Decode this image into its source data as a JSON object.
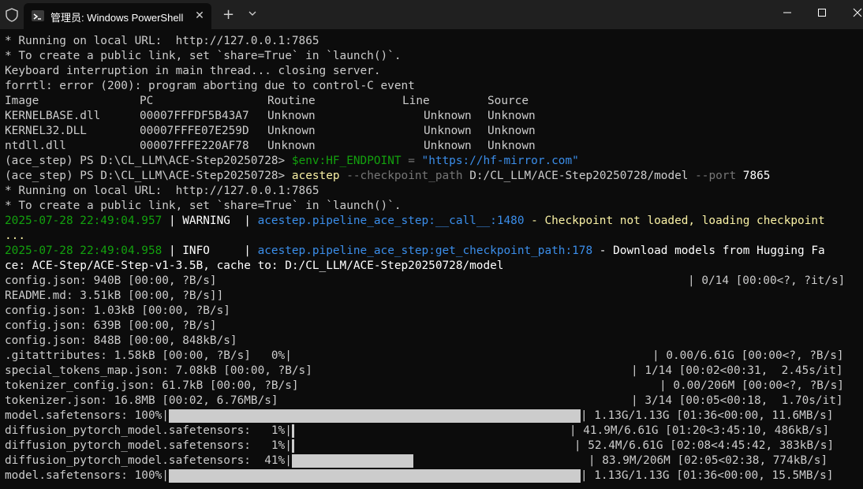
{
  "window": {
    "tab_title": "管理员: Windows PowerShell",
    "tab_close": "✕",
    "new_tab": "+"
  },
  "terminal": {
    "l1": "* Running on local URL:  http://127.0.0.1:7865",
    "l2": "* To create a public link, set `share=True` in `launch()`.",
    "l3": "Keyboard interruption in main thread... closing server.",
    "l4": "forrtl: error (200): program aborting due to control-C event",
    "table_header": [
      "Image",
      "PC",
      "Routine",
      "Line",
      "Source"
    ],
    "table_rows": [
      [
        "KERNELBASE.dll",
        "00007FFFDF5B43A7",
        "Unknown",
        "Unknown",
        "Unknown"
      ],
      [
        "KERNEL32.DLL",
        "00007FFFE07E259D",
        "Unknown",
        "Unknown",
        "Unknown"
      ],
      [
        "ntdll.dll",
        "00007FFFE220AF78",
        "Unknown",
        "Unknown",
        "Unknown"
      ]
    ],
    "prompt": "(ace_step) PS D:\\CL_LLM\\ACE-Step20250728>",
    "cmd1_var": "$env:HF_ENDPOINT",
    "cmd1_eq": " = ",
    "cmd1_val": "\"https://hf-mirror.com\"",
    "cmd2_exe": "acestep",
    "cmd2_flag1": "--checkpoint_path",
    "cmd2_arg1": "D:/CL_LLM/ACE-Step20250728/model",
    "cmd2_flag2": "--port",
    "cmd2_arg2": "7865",
    "l_run": "* Running on local URL:  http://127.0.0.1:7865",
    "l_pub": "* To create a public link, set `share=True` in `launch()`.",
    "log1": {
      "time": "2025-07-28 22:49:04.957",
      "level": " | WARNING  | ",
      "module": "acestep.pipeline_ace_step",
      "func": ":__call__:",
      "lineno": "1480",
      "msg": " - Checkpoint not loaded, loading checkpoint",
      "cont": "..."
    },
    "log2": {
      "time": "2025-07-28 22:49:04.958",
      "level": " | INFO     | ",
      "module": "acestep.pipeline_ace_step",
      "func": ":get_checkpoint_path:",
      "lineno": "178",
      "msg": " - Download models from Hugging Fa",
      "cont": "ce: ACE-Step/ACE-Step-v1-3.5B, cache to: D:/CL_LLM/ACE-Step20250728/model"
    },
    "downloads": [
      {
        "left": "config.json: 940B [00:00, ?B/s]",
        "right": "| 0/14 [00:00<?, ?it/s]"
      },
      {
        "left": "README.md: 3.51kB [00:00, ?B/s]]",
        "right": ""
      },
      {
        "left": "config.json: 1.03kB [00:00, ?B/s]",
        "right": ""
      },
      {
        "left": "config.json: 639B [00:00, ?B/s]",
        "right": ""
      },
      {
        "left": "config.json: 848B [00:00, 848kB/s]",
        "right": ""
      },
      {
        "left": ".gitattributes: 1.58kB [00:00, ?B/s]   0%|",
        "right": "| 0.00/6.61G [00:00<?, ?B/s]"
      },
      {
        "left": "special_tokens_map.json: 7.08kB [00:00, ?B/s]",
        "right": "| 1/14 [00:02<00:31,  2.45s/it]"
      },
      {
        "left": "tokenizer_config.json: 61.7kB [00:00, ?B/s]",
        "right": "| 0.00/206M [00:00<?, ?B/s]"
      },
      {
        "left": "tokenizer.json: 16.8MB [00:02, 6.76MB/s]",
        "right": "| 3/14 [00:05<00:18,  1.70s/it]"
      }
    ],
    "progress": [
      {
        "label": "model.safetensors: 100%|",
        "fraction": 1.0,
        "stats": "| 1.13G/1.13G [01:36<00:00, 11.6MB/s]"
      },
      {
        "label": "diffusion_pytorch_model.safetensors:   1%|",
        "fraction": 0.01,
        "stats": "| 41.9M/6.61G [01:20<3:45:10, 486kB/s]"
      },
      {
        "label": "diffusion_pytorch_model.safetensors:   1%|",
        "fraction": 0.01,
        "stats": "| 52.4M/6.61G [02:08<4:45:42, 383kB/s]"
      },
      {
        "label": "diffusion_pytorch_model.safetensors:  41%|",
        "fraction": 0.41,
        "stats": "| 83.9M/206M [02:05<02:38, 774kB/s]"
      },
      {
        "label": "model.safetensors: 100%|",
        "fraction": 1.0,
        "stats": "| 1.13G/1.13G [01:36<00:00, 15.5MB/s]"
      }
    ]
  }
}
